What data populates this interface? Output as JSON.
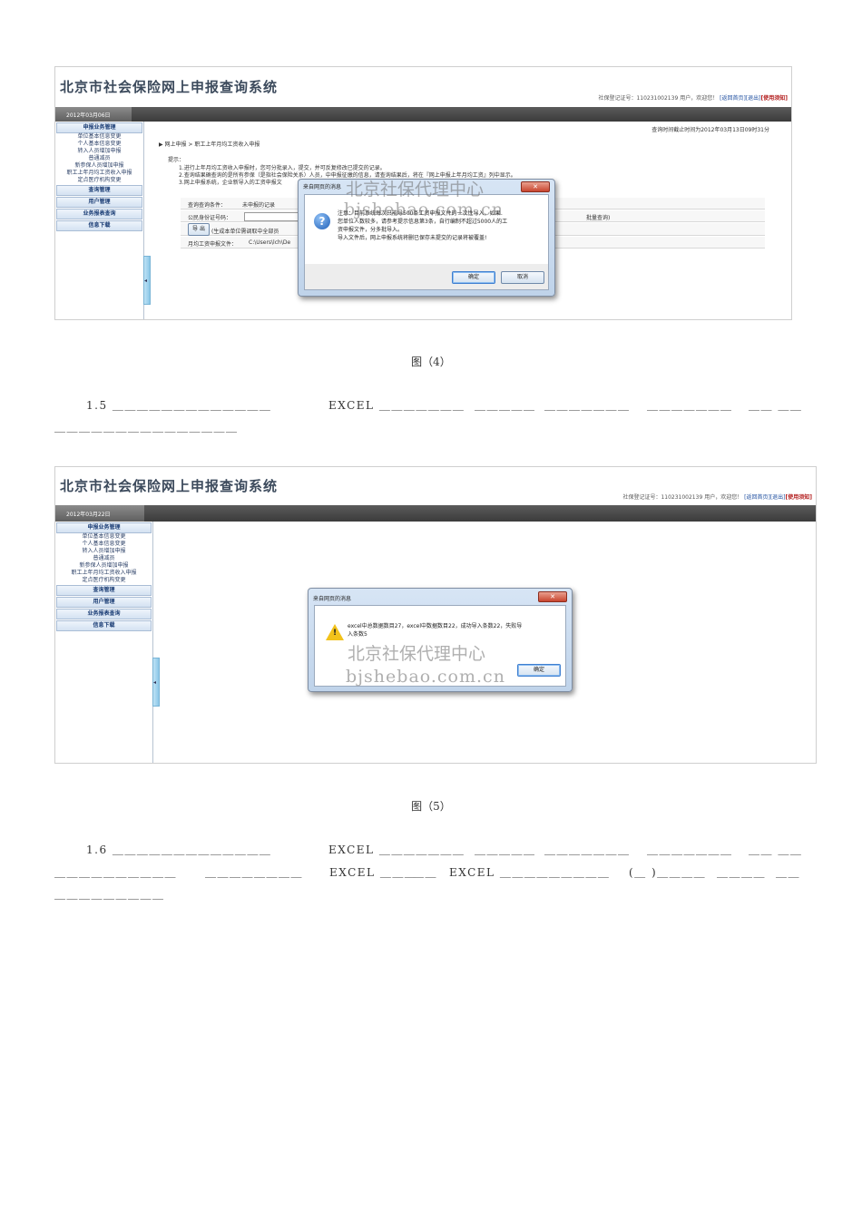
{
  "shot1": {
    "system_title": "北京市社会保险网上申报查询系统",
    "unit_no_label": "社保登记证号：110231002139",
    "user_greeting": "用户，欢迎您！",
    "link_home": "[返回首页]",
    "link_logout": "[退出]",
    "link_notice": "[使用须知]",
    "date": "2012年03月06日",
    "query_time": "查询时间截止时间为2012年03月13日09时31分",
    "nav": [
      {
        "type": "head",
        "label": "申报业务管理"
      },
      {
        "type": "sub",
        "label": "单位基本信息变更"
      },
      {
        "type": "sub",
        "label": "个人基本信息变更"
      },
      {
        "type": "sub",
        "label": "转入人员增加申报"
      },
      {
        "type": "sub",
        "label": "普通减员"
      },
      {
        "type": "sub",
        "label": "新参保人员增加申报"
      },
      {
        "type": "sub",
        "label": "职工上年月均工资收入申报"
      },
      {
        "type": "sub",
        "label": "定点医疗机构变更"
      },
      {
        "type": "head",
        "label": "查询管理"
      },
      {
        "type": "head",
        "label": "用户管理"
      },
      {
        "type": "head",
        "label": "业务报表查询"
      },
      {
        "type": "head",
        "label": "信息下载"
      }
    ],
    "breadcrumb": "▶ 网上申报 > 职工上年月均工资收入申报",
    "tips_label": "提示：",
    "tips": [
      "1.进行上年月均工资收入申报时，您可分批录入，提交，并可反复修改已提交的记录。",
      "2.查询结果确查询的是所有参保（是指社会保险关系）人员，中申报征缴的信息，请查询结果后，将在『网上申报上年月均工资』列中显示。",
      "3.网上申报系统，企业新导入的工资申报文"
    ],
    "form_query_label": "查询查询条件：",
    "form_query_value": "未申报的记录",
    "form_id_label": "公民身份证号码：",
    "form_batch": "批量查询)",
    "form_export_btn": "导 出",
    "form_export_note": "(生成本单位需调取中全部员",
    "form_file_label": "月均工资申报文件：",
    "form_file_value": "C:\\Users\\lch\\De",
    "dialog_title": "来自网页的消息",
    "dialog_msg": [
      "注意：目前系统每次只能导500条工资申报文件的一次性导入，如果",
      "您单位人数较多，请参考提示信息第3条，自行编制不超过5000人的工",
      "资申报文件，分多批导入。",
      "导入文件后，网上申报系统将删已保存未提交的记录将被覆盖!"
    ],
    "btn_ok": "确定",
    "btn_cancel": "取消",
    "watermark_cn": "北京社保代理中心",
    "watermark_en": "bjshebao.com.cn"
  },
  "caption1": "图（4）",
  "para1": {
    "line1": [
      "1.5 ＿＿＿＿＿＿＿＿＿＿＿＿＿",
      "EXCEL ＿＿＿＿＿＿＿",
      "＿＿＿＿＿",
      "＿＿＿＿＿＿＿",
      "＿＿＿＿＿＿＿",
      "＿＿  ＿＿"
    ],
    "line2": "＿＿＿＿＿＿＿＿＿＿＿＿＿＿＿"
  },
  "shot2": {
    "system_title": "北京市社会保险网上申报查询系统",
    "unit_no_label": "社保登记证号：110231002139",
    "user_greeting": "用户，欢迎您！",
    "link_home": "[返回首页]",
    "link_logout": "[退出]",
    "link_notice": "[使用须知]",
    "date": "2012年03月22日",
    "nav": [
      {
        "type": "head",
        "label": "申报业务管理"
      },
      {
        "type": "sub",
        "label": "单位基本信息变更"
      },
      {
        "type": "sub",
        "label": "个人基本信息变更"
      },
      {
        "type": "sub",
        "label": "转入人员增加申报"
      },
      {
        "type": "sub",
        "label": "普通减员"
      },
      {
        "type": "sub",
        "label": "新参保人员增加申报"
      },
      {
        "type": "sub",
        "label": "职工上年月均工资收入申报"
      },
      {
        "type": "sub",
        "label": "定点医疗机构变更"
      },
      {
        "type": "head",
        "label": "查询管理"
      },
      {
        "type": "head",
        "label": "用户管理"
      },
      {
        "type": "head",
        "label": "业务报表查询"
      },
      {
        "type": "head",
        "label": "信息下载"
      }
    ],
    "dialog_title": "来自网页的消息",
    "dialog_msg": [
      "excel中总数据数目27，excel中数据数目22，成功导入条数22，失败导",
      "入条数5"
    ],
    "btn_ok": "确定",
    "watermark_cn": "北京社保代理中心",
    "watermark_en": "bjshebao.com.cn"
  },
  "caption2": "图（5）",
  "para2": {
    "line1": [
      "1.6 ＿＿＿＿＿＿＿＿＿＿＿＿＿",
      "EXCEL ＿＿＿＿＿＿＿",
      "＿＿＿＿＿",
      "＿＿＿＿＿＿＿",
      "＿＿＿＿＿＿＿",
      "＿＿  ＿＿"
    ],
    "line2": [
      "＿＿＿＿＿＿＿＿＿＿",
      "＿＿＿＿＿＿＿＿",
      "EXCEL ＿＿＿",
      "＿＿",
      "EXCEL ＿＿＿＿＿＿＿＿＿",
      "(＿ )＿＿＿＿",
      "＿＿＿＿",
      "＿＿"
    ],
    "line3": "＿＿＿＿＿＿＿＿＿"
  }
}
